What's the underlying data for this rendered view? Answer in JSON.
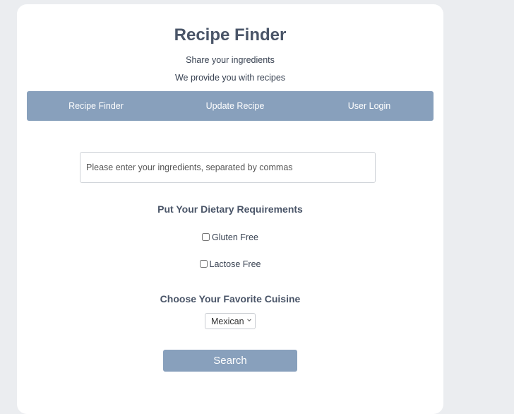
{
  "header": {
    "title": "Recipe Finder",
    "subtitle_1": "Share your ingredients",
    "subtitle_2": "We provide you with recipes"
  },
  "nav": {
    "items": [
      {
        "label": "Recipe Finder"
      },
      {
        "label": "Update Recipe"
      },
      {
        "label": "User Login"
      }
    ]
  },
  "form": {
    "ingredients_placeholder": "Please enter your ingredients, separated by commas",
    "ingredients_value": "",
    "dietary_heading": "Put Your Dietary Requirements",
    "dietary_options": [
      {
        "label": "Gluten Free",
        "checked": false
      },
      {
        "label": "Lactose Free",
        "checked": false
      }
    ],
    "cuisine_heading": "Choose Your Favorite Cuisine",
    "cuisine_selected": "Mexican",
    "search_label": "Search"
  },
  "colors": {
    "background": "#ebedf0",
    "card": "#ffffff",
    "accent": "#88a0bc",
    "heading": "#4a5568"
  },
  "icons": {
    "select_arrow": "chevron-down-icon"
  }
}
